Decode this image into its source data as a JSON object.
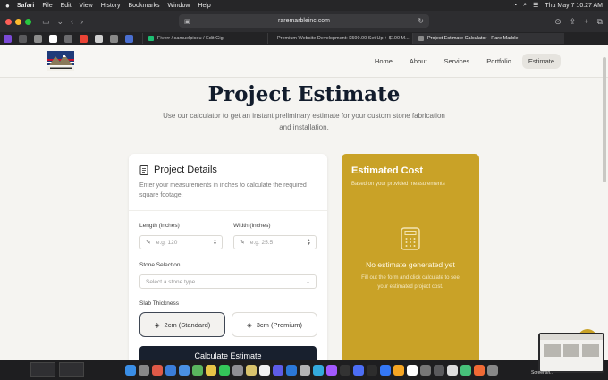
{
  "menubar": {
    "app": "Safari",
    "items": [
      "File",
      "Edit",
      "View",
      "History",
      "Bookmarks",
      "Window",
      "Help"
    ],
    "datetime": "Thu May 7  10:27 AM"
  },
  "browser": {
    "url": "raremarbleinc.com",
    "tabs": [
      {
        "label": "Fiverr / samuelpicou / Edit Gig",
        "color": "#1dbf73"
      },
      {
        "label": "Premium Website Development: $599.00 Set Up + $100 M...",
        "color": "#7b4ad6"
      },
      {
        "label": "Project Estimate Calculator - Rare Marble",
        "color": "#8a8a8a"
      }
    ]
  },
  "site": {
    "nav": [
      "Home",
      "About",
      "Services",
      "Portfolio",
      "Estimate"
    ],
    "title": "Project Estimate",
    "subtitle": "Use our calculator to get an instant preliminary estimate for your custom stone fabrication and installation."
  },
  "details": {
    "title": "Project Details",
    "desc": "Enter your measurements in inches to calculate the required square footage.",
    "length_label": "Length (inches)",
    "length_placeholder": "e.g. 120",
    "width_label": "Width (inches)",
    "width_placeholder": "e.g. 25.5",
    "stone_label": "Stone Selection",
    "stone_placeholder": "Select a stone type",
    "thickness_label": "Slab Thickness",
    "thickness_options": [
      "2cm (Standard)",
      "3cm (Premium)"
    ],
    "selected_thickness": "2cm (Standard)",
    "calculate_label": "Calculate Estimate"
  },
  "cost": {
    "title": "Estimated Cost",
    "subtitle": "Based on your provided measurements",
    "empty_title": "No estimate generated yet",
    "empty_hint": "Fill out the form and click calculate to see your estimated project cost."
  },
  "dock": {
    "screenshot_label": "Screensh..."
  },
  "colors": {
    "accent_gold": "#c9a227",
    "navy": "#18202e"
  }
}
